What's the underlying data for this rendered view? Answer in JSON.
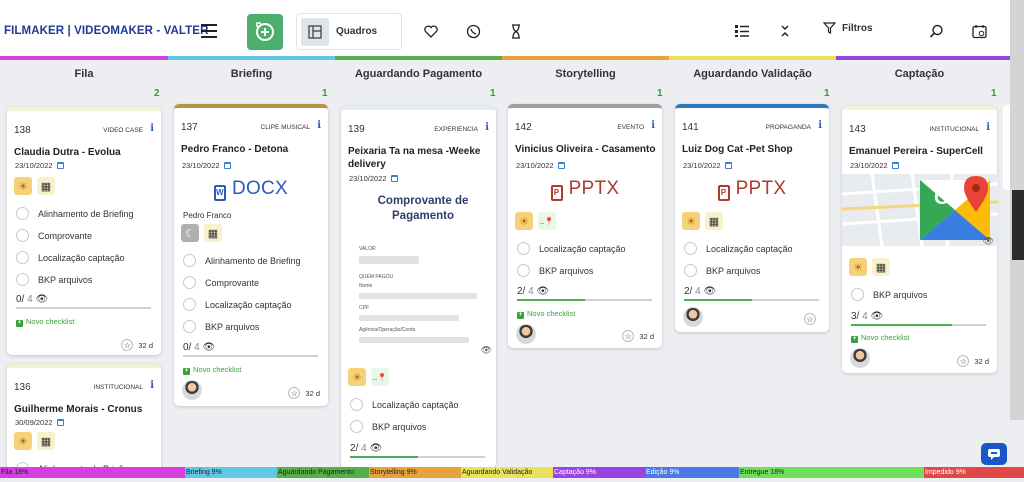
{
  "app": {
    "brand": "FILMAKER | VIDEOMAKER - VALTER"
  },
  "toolbar": {
    "quadros_label": "Quadros",
    "filtros_label": "Filtros"
  },
  "columns": [
    {
      "title": "Fila",
      "count": "2",
      "color": "#d63ee0"
    },
    {
      "title": "Briefing",
      "count": "1",
      "color": "#5ec8e6"
    },
    {
      "title": "Aguardando Pagamento",
      "count": "1",
      "color": "#55b04a"
    },
    {
      "title": "Storytelling",
      "count": "1",
      "color": "#e8a23c"
    },
    {
      "title": "Aguardando Validação",
      "count": "1",
      "color": "#e9e25a"
    },
    {
      "title": "Captação",
      "count": "1",
      "color": "#9a43e0"
    }
  ],
  "cards": {
    "c138": {
      "num": "138",
      "category": "VIDEO CASE",
      "title": "Claudia Dutra - Evolua",
      "date": "23/10/2022",
      "checklist": [
        "Alinhamento de Briefing",
        "Comprovante",
        "Localização captação",
        "BKP arquivos"
      ],
      "progress_done": "0/",
      "progress_total": "4",
      "progress": 0,
      "novo": "Novo checklist",
      "days": "32 d"
    },
    "c136": {
      "num": "136",
      "category": "INSTITUCIONAL",
      "title": "Guilherme Morais - Cronus",
      "date": "30/09/2022",
      "checklist": [
        "Alinhamento de Briefing"
      ]
    },
    "c137": {
      "num": "137",
      "category": "CLIPE MUSICAL",
      "title": "Pedro Franco - Detona",
      "date": "23/10/2022",
      "file": "DOCX",
      "person": "Pedro Franco",
      "checklist": [
        "Alinhamento de Briefing",
        "Comprovante",
        "Localização captação",
        "BKP arquivos"
      ],
      "progress_done": "0/",
      "progress_total": "4",
      "progress": 0,
      "novo": "Novo checklist",
      "days": "32 d"
    },
    "c139": {
      "num": "139",
      "category": "EXPERIENCIA",
      "title": "Peixaria Ta na mesa -Weeke delivery",
      "date": "23/10/2022",
      "receipt_title": "Comprovante de Pagamento",
      "receipt_labels": [
        "VALOR",
        "QUEM PAGOU",
        "Nome",
        "CPF",
        "Agência/Operação/Conta"
      ],
      "pin_label": "..",
      "checklist": [
        "Localização captação",
        "BKP arquivos"
      ],
      "progress_done": "2/",
      "progress_total": "4",
      "progress": 0.5
    },
    "c142": {
      "num": "142",
      "category": "EVENTO",
      "title": "Vinicius Oliveira - Casamento",
      "date": "23/10/2022",
      "file": "PPTX",
      "pin_label": "..",
      "checklist": [
        "Localização captação",
        "BKP arquivos"
      ],
      "progress_done": "2/",
      "progress_total": "4",
      "progress": 0.5,
      "novo": "Novo checklist",
      "days": "32 d"
    },
    "c141": {
      "num": "141",
      "category": "PROPAGANDA",
      "title": "Luiz Dog Cat -Pet Shop",
      "date": "23/10/2022",
      "file": "PPTX",
      "checklist": [
        "Localização captação",
        "BKP arquivos"
      ],
      "progress_done": "2/",
      "progress_total": "4",
      "progress": 0.5
    },
    "c143": {
      "num": "143",
      "category": "INSTITUCIONAL",
      "title": "Emanuel Pereira - SuperCell",
      "date": "23/10/2022",
      "checklist": [
        "BKP arquivos"
      ],
      "progress_done": "3/",
      "progress_total": "4",
      "progress": 0.75,
      "novo": "Novo checklist",
      "days": "32 d"
    }
  },
  "status_bar": [
    {
      "label": "Fila 18%",
      "color": "#d63ee0"
    },
    {
      "label": "Briefing 9%",
      "color": "#5ec8e6"
    },
    {
      "label": "Aguardando Pagamento",
      "color": "#55b04a"
    },
    {
      "label": "Storytelling 9%",
      "color": "#e8a23c"
    },
    {
      "label": "Aguardando Validação",
      "color": "#e9e25a"
    },
    {
      "label": "Captação 9%",
      "color": "#9a43e0"
    },
    {
      "label": "Edição 9%",
      "color": "#4a78e6"
    },
    {
      "label": "Entregue 18%",
      "color": "#6fe05a"
    },
    {
      "label": "Impedido 9%",
      "color": "#e04848"
    }
  ]
}
